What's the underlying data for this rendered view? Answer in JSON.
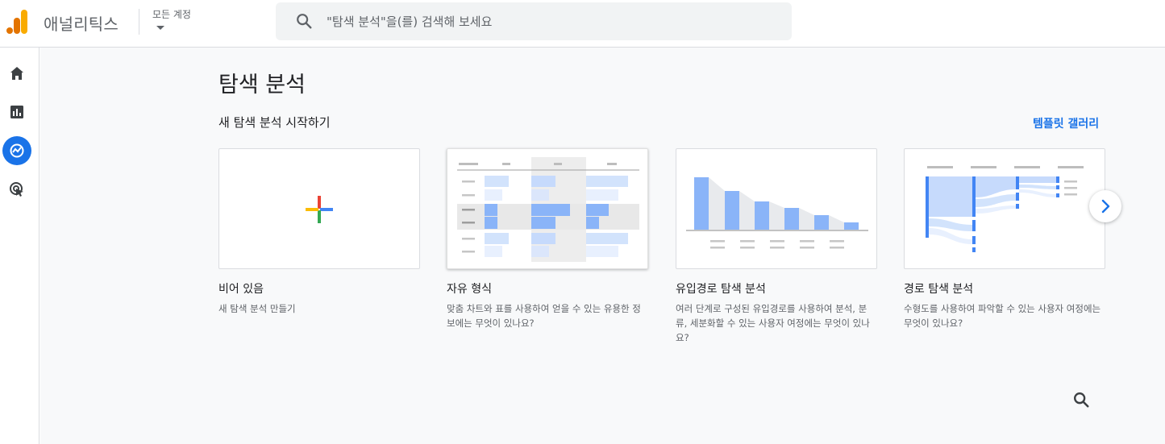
{
  "header": {
    "app_title": "애널리틱스",
    "account_label": "모든 계정",
    "search_placeholder": "\"탐색 분석\"을(를) 검색해 보세요"
  },
  "nav": {
    "items": [
      {
        "icon": "home-icon"
      },
      {
        "icon": "reports-icon"
      },
      {
        "icon": "explore-icon",
        "active": true
      },
      {
        "icon": "advertising-icon"
      }
    ]
  },
  "main": {
    "page_title": "탐색 분석",
    "section_title": "새 탐색 분석 시작하기",
    "template_gallery_link": "템플릿 갤러리",
    "cards": [
      {
        "title": "비어 있음",
        "desc": "새 탐색 분석 만들기"
      },
      {
        "title": "자유 형식",
        "desc": "맞춤 차트와 표를 사용하여 얻을 수 있는 유용한 정보에는 무엇이 있나요?"
      },
      {
        "title": "유입경로 탐색 분석",
        "desc": "여러 단계로 구성된 유입경로를 사용하여 분석, 분류, 세분화할 수 있는 사용자 여정에는 무엇이 있나요?"
      },
      {
        "title": "경로 탐색 분석",
        "desc": "수형도를 사용하여 파악할 수 있는 사용자 여정에는 무엇이 있나요?"
      }
    ]
  },
  "colors": {
    "accent": "#1a73e8",
    "logo_orange": "#f9ab00",
    "logo_dark_orange": "#e37400",
    "plus_red": "#ea4335",
    "plus_blue": "#4285f4",
    "plus_green": "#34a853",
    "plus_yellow": "#fbbc04"
  }
}
